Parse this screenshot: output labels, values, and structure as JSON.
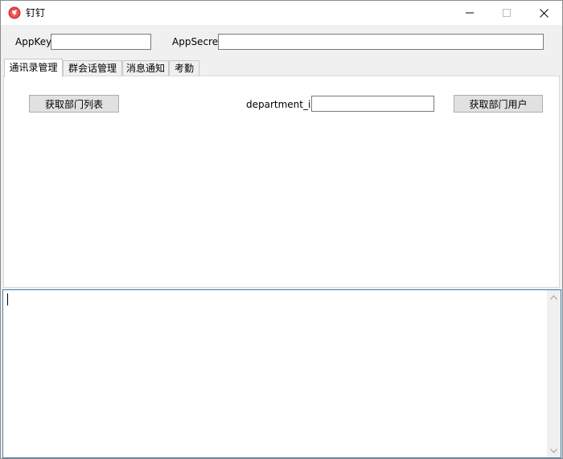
{
  "window": {
    "title": "钉钉",
    "icon": "dingtalk-app-icon",
    "controls": [
      "minimize-icon",
      "maximize-icon",
      "close-icon"
    ]
  },
  "credentials": {
    "appkey_label": "AppKey",
    "appkey_value": "",
    "appsecret_label": "AppSecret",
    "appsecret_value": ""
  },
  "tabs": [
    {
      "label": "通讯录管理",
      "active": true
    },
    {
      "label": "群会话管理",
      "active": false
    },
    {
      "label": "消息通知",
      "active": false
    },
    {
      "label": "考勤",
      "active": false
    }
  ],
  "contacts_panel": {
    "get_departments_label": "获取部门列表",
    "department_id_label": "department_id",
    "department_id_value": "",
    "get_users_label": "获取部门用户"
  },
  "log": {
    "text": ""
  },
  "colors": {
    "window_bg": "#f0f0f0",
    "button_bg": "#e1e1e1",
    "focus_border": "#3c7fb1",
    "icon_red": "#e53935"
  }
}
